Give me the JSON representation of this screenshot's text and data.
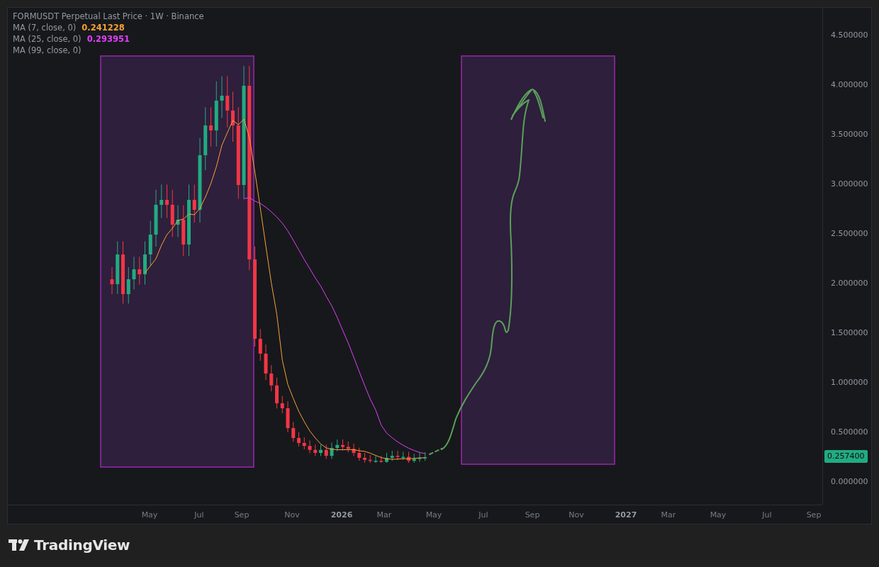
{
  "chart": {
    "title": "FORMUSDT Perpetual Last Price · 1W · Binance",
    "indicators": [
      {
        "label": "MA (7, close, 0)",
        "value": "0.241228",
        "color": "#f7a136"
      },
      {
        "label": "MA (25, close, 0)",
        "value": "0.293951",
        "color": "#e040fb"
      },
      {
        "label": "MA (99, close, 0)"
      }
    ],
    "price_axis": [
      "4.500000",
      "4.000000",
      "3.500000",
      "3.000000",
      "2.500000",
      "2.000000",
      "1.500000",
      "1.000000",
      "0.500000",
      "0.000000"
    ],
    "last_price": "0.257400",
    "time_axis": [
      {
        "label": "May",
        "kind": "month"
      },
      {
        "label": "Jul",
        "kind": "month"
      },
      {
        "label": "Sep",
        "kind": "month"
      },
      {
        "label": "Nov",
        "kind": "month"
      },
      {
        "label": "2026",
        "kind": "year"
      },
      {
        "label": "Mar",
        "kind": "month"
      },
      {
        "label": "May",
        "kind": "month"
      },
      {
        "label": "Jul",
        "kind": "month"
      },
      {
        "label": "Sep",
        "kind": "month"
      },
      {
        "label": "Nov",
        "kind": "month"
      },
      {
        "label": "2027",
        "kind": "year"
      },
      {
        "label": "Mar",
        "kind": "month"
      },
      {
        "label": "May",
        "kind": "month"
      },
      {
        "label": "Jul",
        "kind": "month"
      },
      {
        "label": "Sep",
        "kind": "month"
      }
    ]
  },
  "footer": {
    "brand": "TradingView"
  }
}
